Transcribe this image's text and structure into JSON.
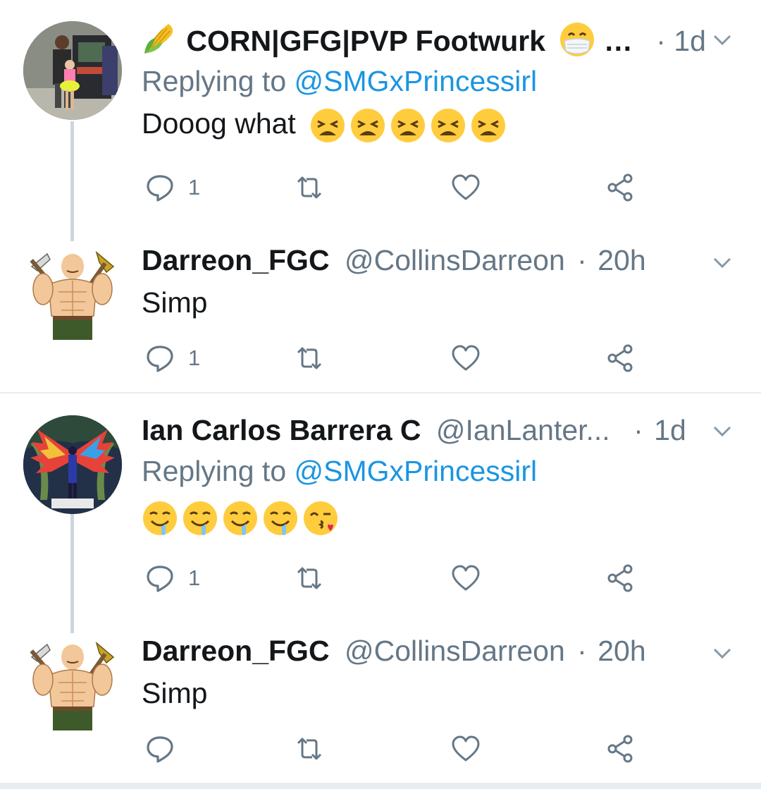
{
  "tweets": [
    {
      "display_name": "CORN|GFG|PVP Footwurk",
      "name_prefix_icon": "corn-icon",
      "name_suffix_icon": "face-with-medical-mask-icon",
      "truncation": "…",
      "dot": "·",
      "time": "1d",
      "replying_label": "Replying to",
      "replying_to": "@SMGxPrincessirl",
      "text": "Dooog what",
      "emojis": [
        "weary-face-icon",
        "weary-face-icon",
        "weary-face-icon",
        "weary-face-icon",
        "weary-face-icon"
      ],
      "reply_count": "1",
      "avatar_icon": "arcade-photo-avatar"
    },
    {
      "display_name": "Darreon_FGC",
      "handle": "@CollinsDarreon",
      "dot": "·",
      "time": "20h",
      "text": "Simp",
      "emojis": [],
      "reply_count": "1",
      "avatar_icon": "muscle-man-axe-avatar"
    },
    {
      "display_name": "Ian Carlos Barrera C",
      "handle": "@IanLanter...",
      "dot": "·",
      "time": "1d",
      "replying_label": "Replying to",
      "replying_to": "@SMGxPrincessirl",
      "text": "",
      "emojis": [
        "drooling-face-icon",
        "drooling-face-icon",
        "drooling-face-icon",
        "drooling-face-icon",
        "face-blowing-kiss-icon"
      ],
      "reply_count": "1",
      "avatar_icon": "winged-figure-avatar"
    },
    {
      "display_name": "Darreon_FGC",
      "handle": "@CollinsDarreon",
      "dot": "·",
      "time": "20h",
      "text": "Simp",
      "emojis": [],
      "reply_count": "",
      "avatar_icon": "muscle-man-axe-avatar"
    }
  ],
  "colors": {
    "text": "#14171a",
    "secondary": "#657786",
    "link": "#1b95e0",
    "divider": "#e6ecf0",
    "thread_line": "#ccd6dd"
  }
}
